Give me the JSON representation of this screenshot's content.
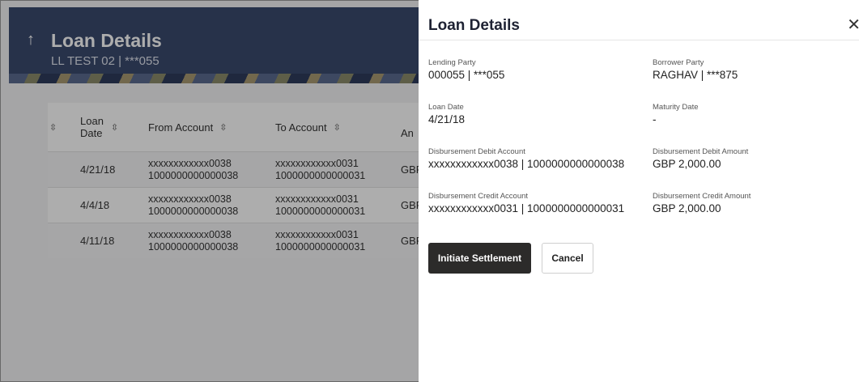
{
  "background": {
    "title": "Loan Details",
    "subtitle": "LL TEST 02 | ***055",
    "table": {
      "headers": [
        "Loan Date",
        "From Account",
        "To Account",
        "An"
      ],
      "rows": [
        {
          "date": "4/21/18",
          "from_1": "xxxxxxxxxxxx0038",
          "from_2": "1000000000000038",
          "to_1": "xxxxxxxxxxxx0031",
          "to_2": "1000000000000031",
          "ccy": "GBP"
        },
        {
          "date": "4/4/18",
          "from_1": "xxxxxxxxxxxx0038",
          "from_2": "1000000000000038",
          "to_1": "xxxxxxxxxxxx0031",
          "to_2": "1000000000000031",
          "ccy": "GBP"
        },
        {
          "date": "4/11/18",
          "from_1": "xxxxxxxxxxxx0038",
          "from_2": "1000000000000038",
          "to_1": "xxxxxxxxxxxx0031",
          "to_2": "1000000000000031",
          "ccy": "GBP"
        }
      ]
    }
  },
  "drawer": {
    "title": "Loan Details",
    "fields": {
      "lending_party": {
        "label": "Lending Party",
        "value": "000055 | ***055"
      },
      "borrower_party": {
        "label": "Borrower Party",
        "value": "RAGHAV | ***875"
      },
      "loan_date": {
        "label": "Loan Date",
        "value": "4/21/18"
      },
      "maturity_date": {
        "label": "Maturity Date",
        "value": "-"
      },
      "debit_account": {
        "label": "Disbursement Debit Account",
        "value": "xxxxxxxxxxxx0038 | 1000000000000038"
      },
      "debit_amount": {
        "label": "Disbursement Debit Amount",
        "value": "GBP 2,000.00"
      },
      "credit_account": {
        "label": "Disbursement Credit Account",
        "value": "xxxxxxxxxxxx0031 | 1000000000000031"
      },
      "credit_amount": {
        "label": "Disbursement Credit Amount",
        "value": "GBP 2,000.00"
      }
    },
    "buttons": {
      "initiate": "Initiate Settlement",
      "cancel": "Cancel"
    }
  },
  "icons": {
    "back": "up-arrow-icon",
    "close": "close-icon",
    "sort": "sort-icon"
  }
}
